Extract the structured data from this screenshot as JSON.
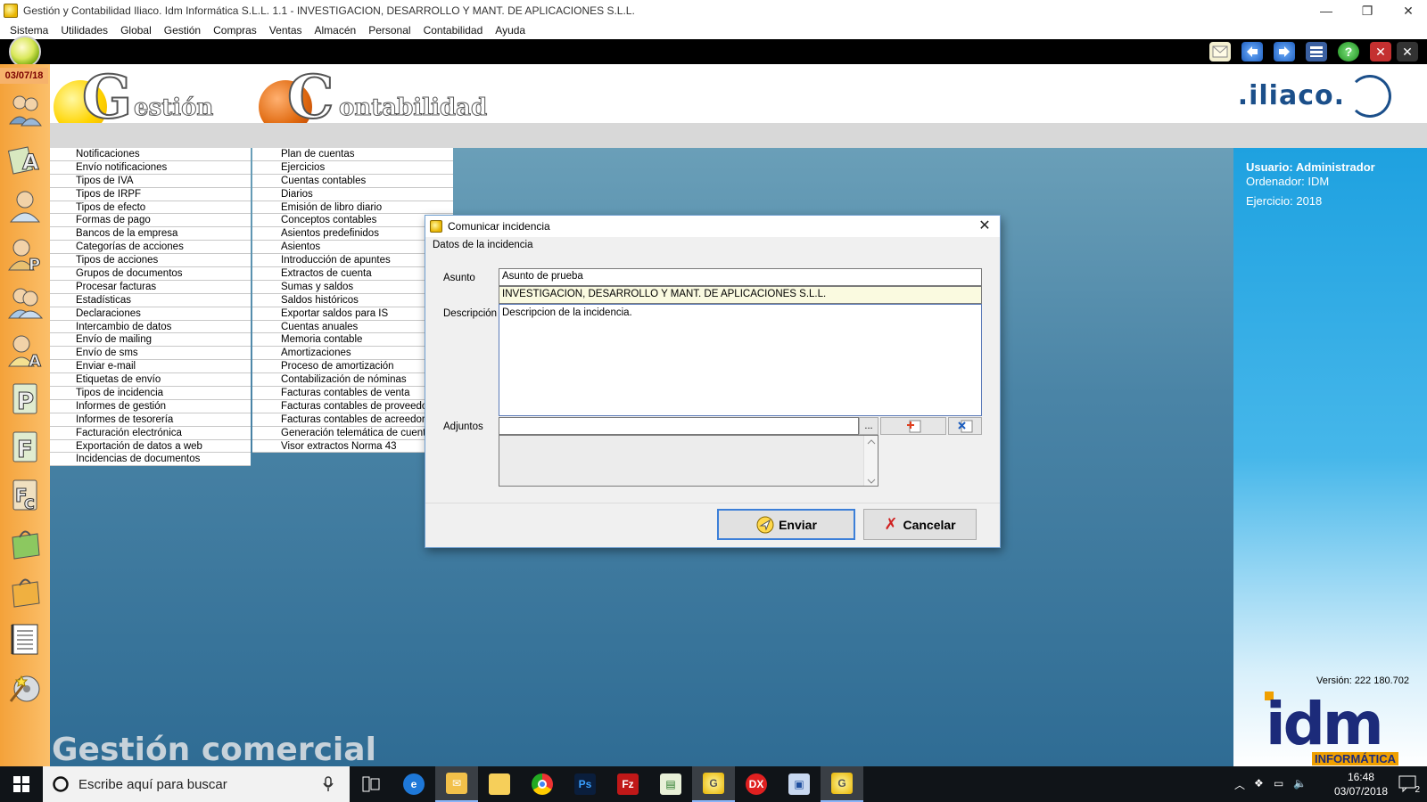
{
  "window": {
    "title": "Gestión y Contabilidad Iliaco. Idm Informática S.L.L. 1.1 - INVESTIGACION, DESARROLLO Y MANT. DE APLICACIONES S.L.L.",
    "minimize": "—",
    "restore": "❐",
    "close": "✕"
  },
  "menubar": [
    "Sistema",
    "Utilidades",
    "Global",
    "Gestión",
    "Compras",
    "Ventas",
    "Almacén",
    "Personal",
    "Contabilidad",
    "Ayuda"
  ],
  "sidebar": {
    "date": "03/07/18",
    "icons": [
      "users-group-icon",
      "accounting-a-icon",
      "user-icon",
      "user-p-icon",
      "users-pair-icon",
      "user-a-icon",
      "document-p-icon",
      "document-f-icon",
      "document-fc-icon",
      "bag-green-icon",
      "bag-orange-icon",
      "ledger-icon",
      "disc-wizard-icon"
    ]
  },
  "header": {
    "logo1_letter": "G",
    "logo1_word": "estión",
    "logo2_letter": "C",
    "logo2_word": "ontabilidad",
    "brand": ".iliaco."
  },
  "menu_gestion": [
    "Notificaciones",
    "Envío notificaciones",
    "Tipos de IVA",
    "Tipos de IRPF",
    "Tipos de efecto",
    "Formas de pago",
    "Bancos de la empresa",
    "Categorías de acciones",
    "Tipos de acciones",
    "Grupos de documentos",
    "Procesar facturas",
    "Estadísticas",
    "Declaraciones",
    "Intercambio de datos",
    "Envío de mailing",
    "Envío de sms",
    "Enviar e-mail",
    "Etiquetas de envío",
    "Tipos de incidencia",
    "Informes de gestión",
    "Informes de tesorería",
    "Facturación electrónica",
    "Exportación de datos a web",
    "Incidencias de documentos"
  ],
  "menu_contabilidad": [
    "Plan de cuentas",
    "Ejercicios",
    "Cuentas contables",
    "Diarios",
    "Emisión de libro diario",
    "Conceptos contables",
    "Asientos predefinidos",
    "Asientos",
    "Introducción de apuntes",
    "Extractos de cuenta",
    "Sumas y saldos",
    "Saldos históricos",
    "Exportar saldos para IS",
    "Cuentas anuales",
    "Memoria contable",
    "Amortizaciones",
    "Proceso de amortización",
    "Contabilización de nóminas",
    "Facturas contables de venta",
    "Facturas contables de proveedor",
    "Facturas contables de acreedor",
    "Generación telemática de cuentas",
    "Visor extractos Norma 43"
  ],
  "main": {
    "bottom_title": "Gestión comercial"
  },
  "info": {
    "usuario": "Usuario: Administrador",
    "ordenador": "Ordenador: IDM",
    "ejercicio": "Ejercicio: 2018",
    "version": "Versión: 222 180.702",
    "idm_logo": "idm",
    "idm_sub": "INFORMÁTICA"
  },
  "dialog": {
    "title": "Comunicar incidencia",
    "group_label": "Datos de la incidencia",
    "asunto_label": "Asunto",
    "asunto_value": "Asunto de prueba",
    "company_value": "INVESTIGACION, DESARROLLO Y MANT. DE APLICACIONES S.L.L.",
    "descripcion_label": "Descripción",
    "descripcion_value": "Descripcion de la incidencia.",
    "adjuntos_label": "Adjuntos",
    "browse_label": "...",
    "enviar_label": "Enviar",
    "cancelar_label": "Cancelar"
  },
  "taskbar": {
    "search_placeholder": "Escribe aquí para buscar",
    "time": "16:48",
    "date": "03/07/2018",
    "notifications": "2",
    "apps": [
      "task-view-icon",
      "edge-icon",
      "mail-folder-icon",
      "file-explorer-icon",
      "chrome-icon",
      "photoshop-icon",
      "filezilla-icon",
      "notepad-chart-icon",
      "gestion-app-icon",
      "devexpress-icon",
      "network-pc-icon",
      "iliaco-app-icon"
    ]
  },
  "colors": {
    "sidebar": "#f4a23a",
    "main_bg": "#4a84a6",
    "info_panel": "#1ea1e0",
    "brand_blue": "#1b4f8a",
    "primary_button_border": "#3c7fd8"
  }
}
